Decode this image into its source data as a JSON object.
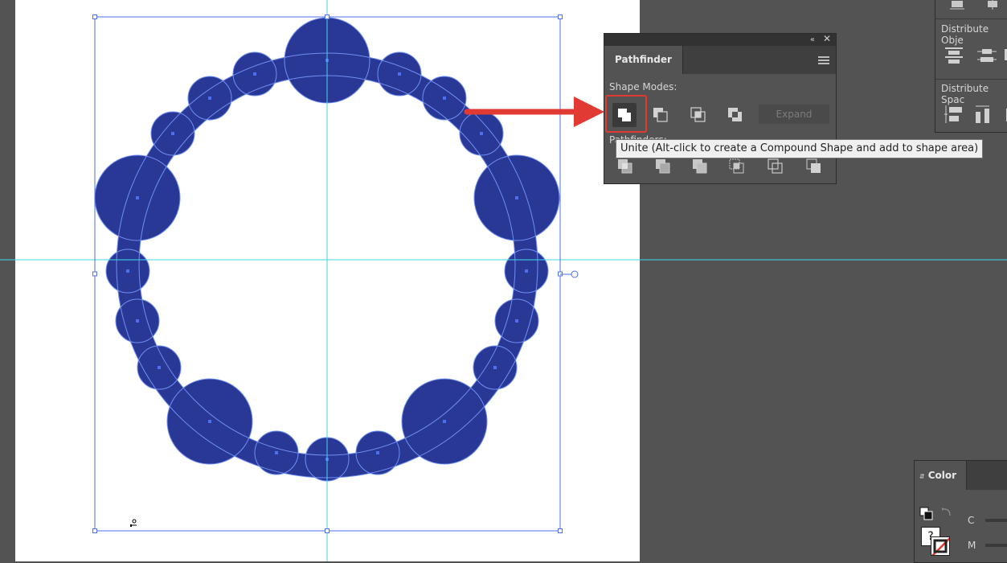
{
  "pathfinder": {
    "tab_label": "Pathfinder",
    "shape_modes_label": "Shape Modes:",
    "pathfinders_label": "Pathfinders:",
    "expand_label": "Expand",
    "shape_mode_buttons": [
      "unite",
      "minus-front",
      "intersect",
      "exclude"
    ],
    "pathfinder_buttons": [
      "divide",
      "trim",
      "merge",
      "crop",
      "outline",
      "minus-back"
    ],
    "tooltip": "Unite (Alt-click to create a Compound Shape and add to shape area)"
  },
  "align_panel": {
    "distribute_objects_label": "Distribute Obje",
    "distribute_spacing_label": "Distribute Spac"
  },
  "color_panel": {
    "tab_label": "Color",
    "channel_c": "C",
    "channel_m": "M",
    "question_mark": "?"
  },
  "colors": {
    "shape_fill": "#2a3895",
    "shape_stroke": "#6f8ff5",
    "selection": "#4d6ff0",
    "guide": "#3fd7e8",
    "highlight": "#e03a32",
    "arrow": "#e03a32"
  }
}
